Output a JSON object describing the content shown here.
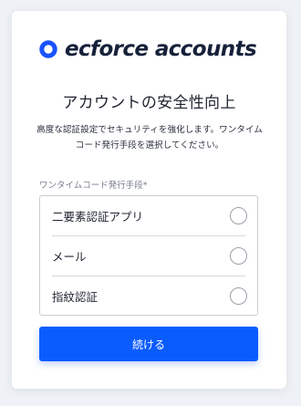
{
  "brand": {
    "name": "ecforce accounts",
    "logo_icon": "ring-logo-icon",
    "color": "#1a52ff"
  },
  "page": {
    "title": "アカウントの安全性向上",
    "description": "高度な認証設定でセキュリティを強化します。ワンタイムコード発行手段を選択してください。"
  },
  "form": {
    "field_label": "ワンタイムコード発行手段*",
    "options": [
      {
        "label": "二要素認証アプリ",
        "selected": false
      },
      {
        "label": "メール",
        "selected": false
      },
      {
        "label": "指紋認証",
        "selected": false
      }
    ],
    "submit_label": "続ける",
    "submit_color": "#0b5cff"
  }
}
